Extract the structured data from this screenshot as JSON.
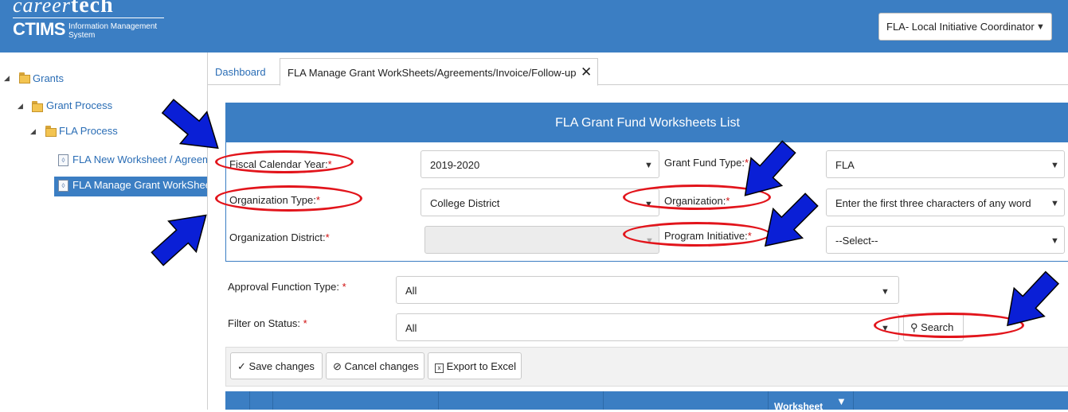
{
  "header": {
    "logo_top_italic": "career",
    "logo_top_bold": "tech",
    "logo_ctims": "CTIMS",
    "logo_subtitle_1": "Information Management",
    "logo_subtitle_2": "System",
    "role_select_value": "FLA- Local Initiative Coordinator"
  },
  "sidebar": {
    "items": [
      {
        "label": "Grants"
      },
      {
        "label": "Grant Process"
      },
      {
        "label": "FLA Process"
      },
      {
        "label": "FLA New Worksheet / Agreem"
      },
      {
        "label": "FLA Manage Grant WorkShee"
      }
    ]
  },
  "tabs": [
    {
      "label": "Dashboard"
    },
    {
      "label": "FLA Manage Grant WorkSheets/Agreements/Invoice/Follow-up"
    }
  ],
  "panel": {
    "title": "FLA Grant Fund Worksheets List",
    "fiscal_year_label": "Fiscal Calendar Year:",
    "fiscal_year_value": "2019-2020",
    "grant_fund_type_label": "Grant Fund Type:",
    "grant_fund_type_value": "FLA",
    "org_type_label": "Organization Type:",
    "org_type_value": "College District",
    "organization_label": "Organization:",
    "organization_value": "Enter the first three characters of any word",
    "org_district_label": "Organization District:",
    "org_district_value": "",
    "program_initiative_label": "Program Initiative:",
    "program_initiative_value": "--Select--",
    "required_mark": "*"
  },
  "filters": {
    "approval_label": "Approval Function Type: ",
    "approval_value": "All",
    "status_label": "Filter on Status: ",
    "status_value": "All",
    "search_label": "Search"
  },
  "toolbar": {
    "save_label": "Save changes",
    "cancel_label": "Cancel changes",
    "export_label": "Export to Excel"
  },
  "grid": {
    "worksheet_header": "Worksheet"
  },
  "colors": {
    "header_blue": "#3b7ec3",
    "annotation_red": "#e2141b",
    "annotation_arrow": "#0a1fd6"
  }
}
